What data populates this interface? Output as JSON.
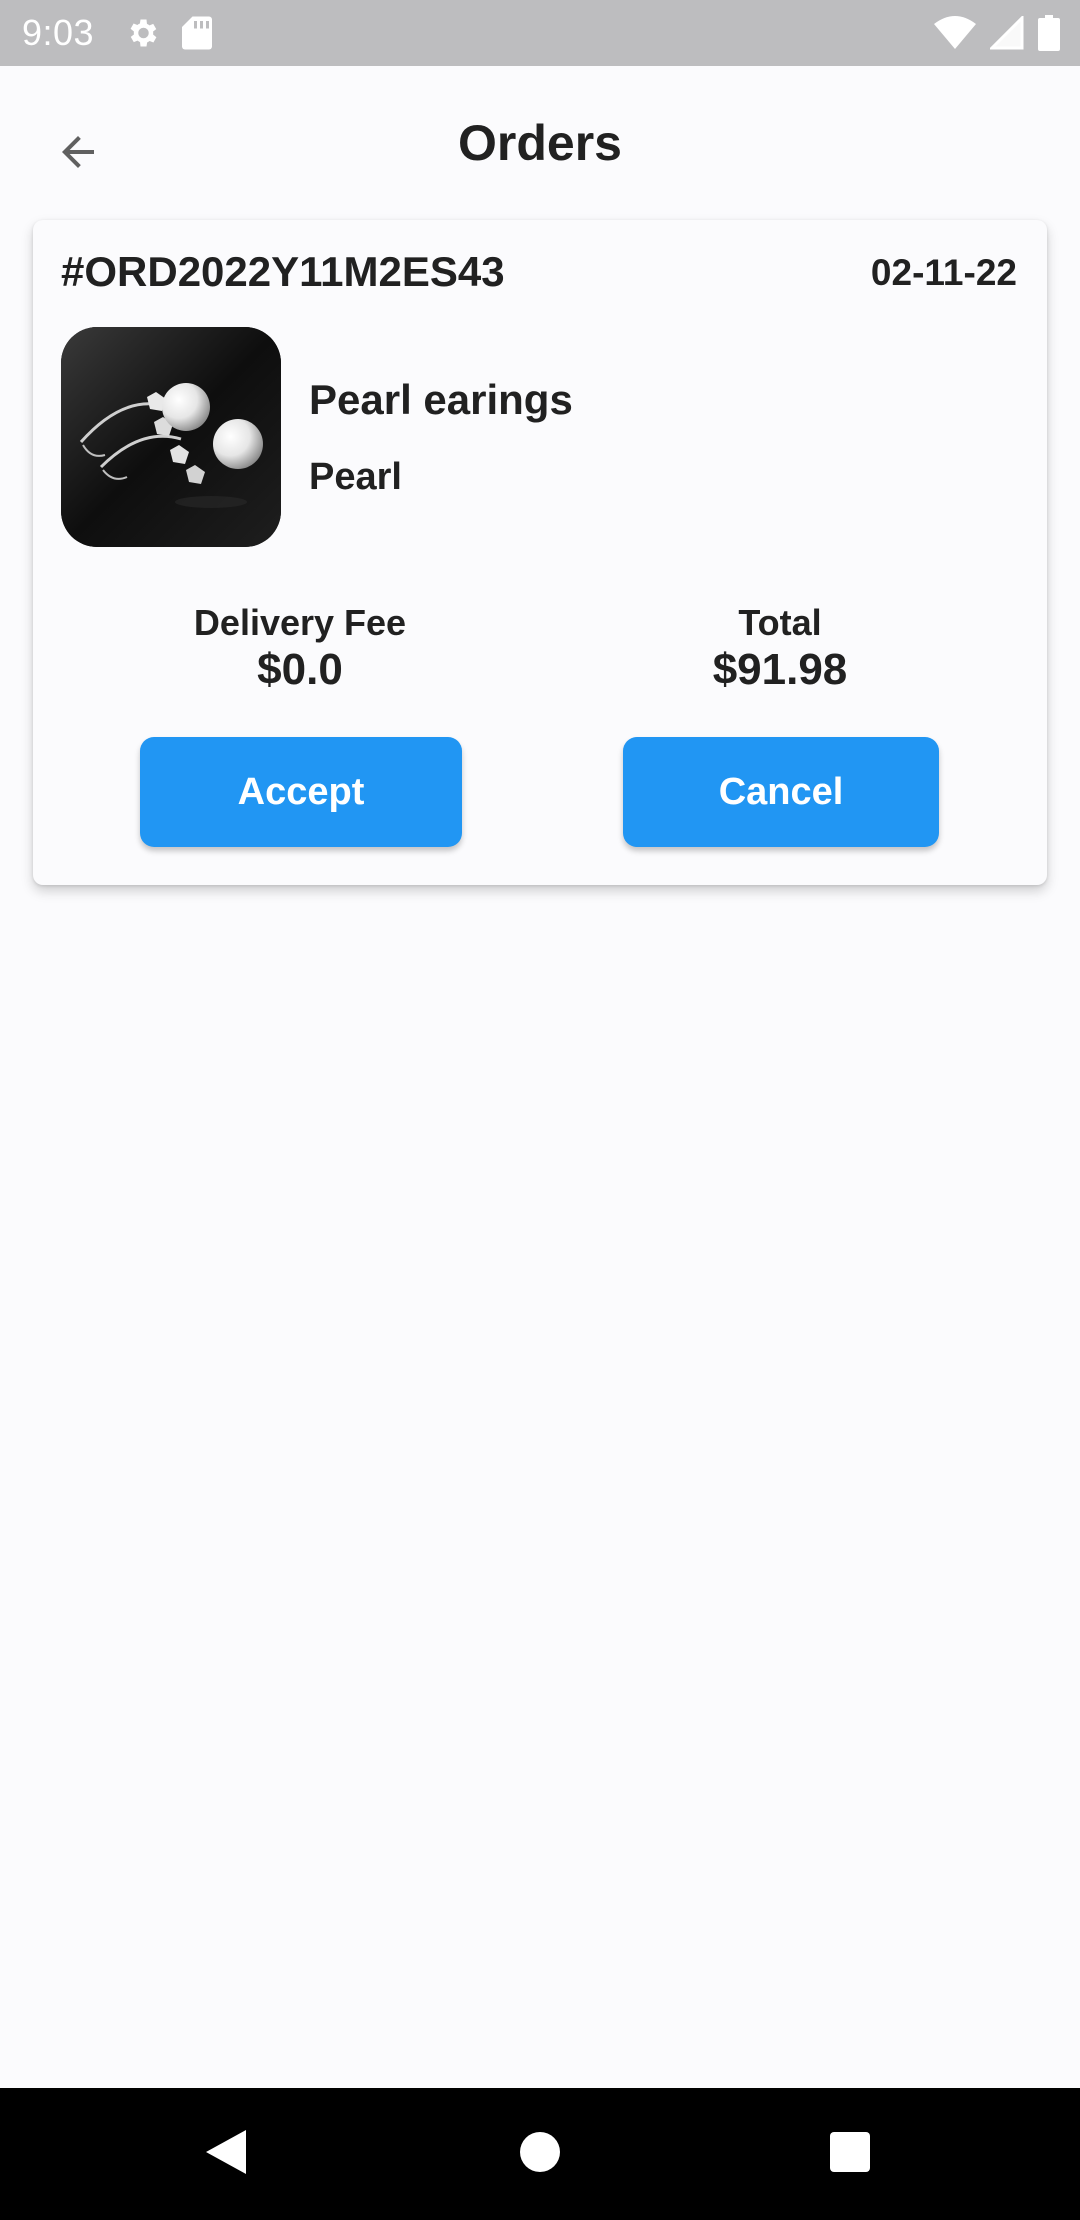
{
  "status_bar": {
    "time": "9:03",
    "left_icons": [
      "settings-icon",
      "sd-card-icon"
    ],
    "right_icons": [
      "wifi-icon",
      "signal-icon",
      "battery-icon"
    ]
  },
  "app_bar": {
    "title": "Orders",
    "back_icon": "arrow-back-icon"
  },
  "order": {
    "id": "#ORD2022Y11M2ES43",
    "date": "02-11-22",
    "product": {
      "name": "Pearl earings",
      "category": "Pearl",
      "image": "pearl-earrings-image"
    },
    "delivery_fee_label": "Delivery Fee",
    "delivery_fee_value": "$0.0",
    "total_label": "Total",
    "total_value": "$91.98",
    "accept_label": "Accept",
    "cancel_label": "Cancel"
  },
  "nav_bar": {
    "buttons": [
      "nav-back-icon",
      "nav-home-icon",
      "nav-recents-icon"
    ]
  },
  "colors": {
    "accent": "#2196f3",
    "background": "#fbfbfd",
    "status_bar": "#bdbdbf",
    "nav_bar": "#000000",
    "text": "#212121"
  }
}
